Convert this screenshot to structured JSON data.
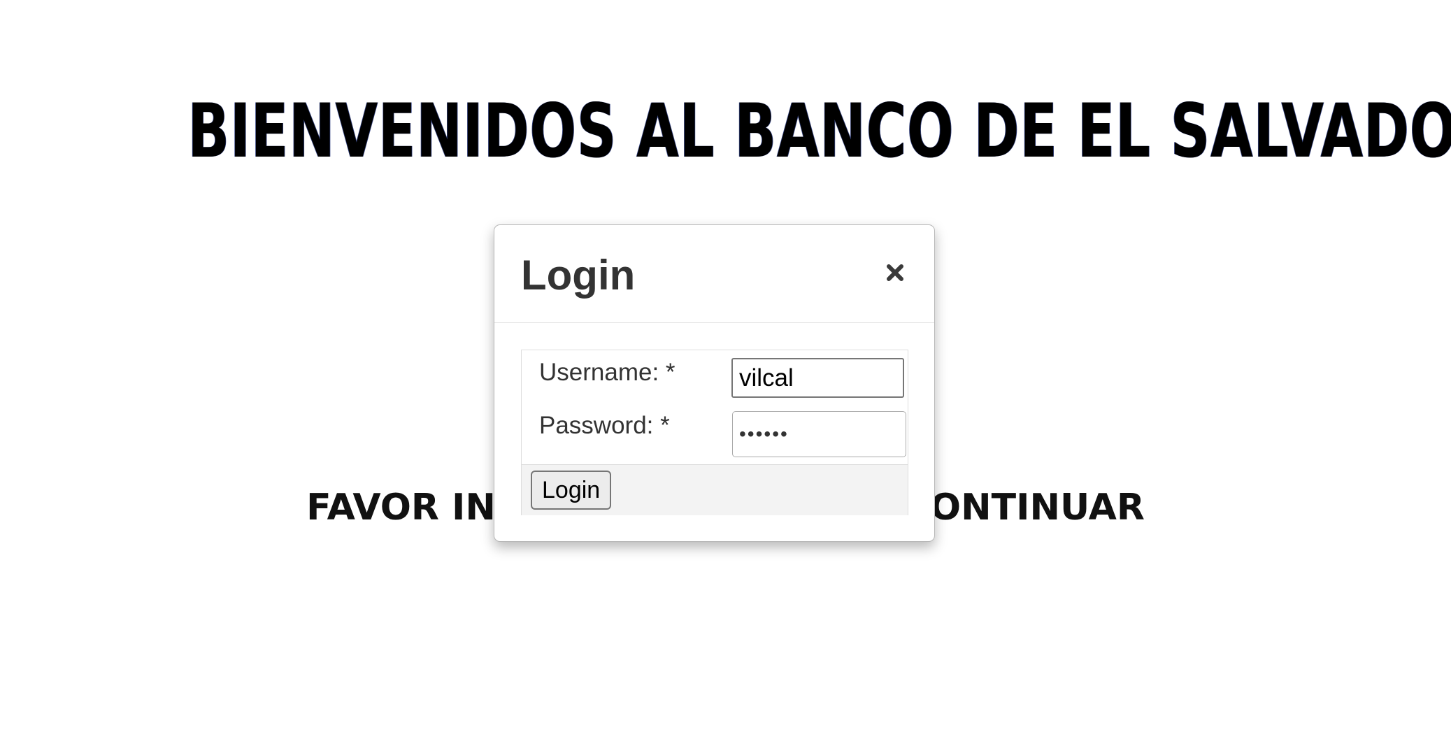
{
  "page": {
    "banner": "BIENVENIDOS AL BANCO DE EL SALVADOR",
    "subtext": "FAVOR INICIAR SESION PARA CONTINUAR"
  },
  "dialog": {
    "title": "Login",
    "close_icon": "close-icon",
    "username_label": "Username:  *",
    "username_value": "vilcal",
    "password_label": "Password:  *",
    "password_value": "secret",
    "submit_label": "Login"
  },
  "colors": {
    "banner_text": "#000000",
    "dialog_title": "#333333",
    "form_footer_bg": "#f3f3f3",
    "button_bg": "#ececec"
  }
}
